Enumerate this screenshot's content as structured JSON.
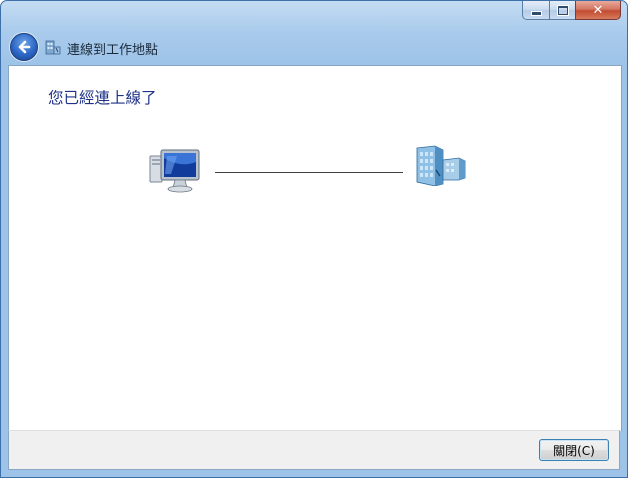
{
  "window": {
    "title": "連線到工作地點",
    "caption_buttons": {
      "minimize": "minimize",
      "maximize": "maximize",
      "close": "✕"
    }
  },
  "content": {
    "heading": "您已經連上線了",
    "left_icon": "computer-icon",
    "right_icon": "office-building-icon"
  },
  "footer": {
    "close_label": "關閉(C)"
  },
  "colors": {
    "heading": "#1e3287",
    "chrome": "#a9cbec",
    "footer": "#f0f0f0"
  }
}
